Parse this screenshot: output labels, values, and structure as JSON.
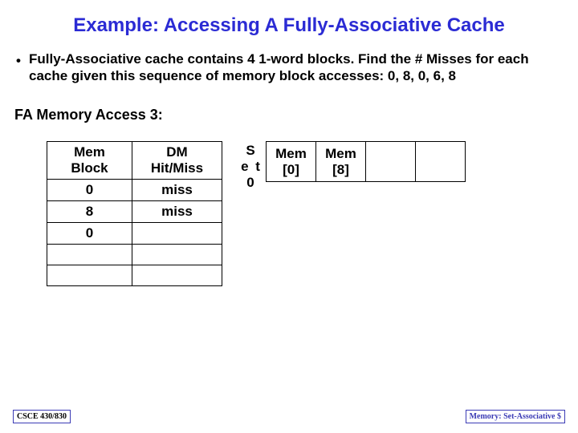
{
  "title": "Example: Accessing A Fully-Associative Cache",
  "bullet": {
    "text": "Fully-Associative cache contains 4 1-word blocks. Find the # Misses for each cache given this sequence of memory block accesses: 0, 8, 0, 6, 8"
  },
  "access_heading": "FA Memory Access 3:",
  "access_table": {
    "headers": {
      "col_a": "Mem Block",
      "col_b": "DM Hit/Miss"
    },
    "rows": [
      {
        "block": "0",
        "result": "miss"
      },
      {
        "block": "8",
        "result": "miss"
      },
      {
        "block": "0",
        "result": ""
      },
      {
        "block": "",
        "result": ""
      },
      {
        "block": "",
        "result": ""
      }
    ]
  },
  "cache": {
    "set_label_line1": "S",
    "set_label_line2": "e t",
    "set_label_line3": "0",
    "cells": [
      "Mem [0]",
      "Mem [8]",
      "",
      ""
    ]
  },
  "footer": {
    "left": "CSCE 430/830",
    "right": "Memory: Set-Associative $"
  },
  "chart_data": {
    "type": "table",
    "title": "FA Memory Access 3 — access trace and cache contents",
    "access_sequence": [
      0,
      8,
      0,
      6,
      8
    ],
    "trace": [
      {
        "mem_block": 0,
        "result": "miss"
      },
      {
        "mem_block": 8,
        "result": "miss"
      },
      {
        "mem_block": 0,
        "result": null
      },
      {
        "mem_block": null,
        "result": null
      },
      {
        "mem_block": null,
        "result": null
      }
    ],
    "cache_blocks": 4,
    "set": 0,
    "cache_contents": [
      "Mem[0]",
      "Mem[8]",
      null,
      null
    ]
  }
}
